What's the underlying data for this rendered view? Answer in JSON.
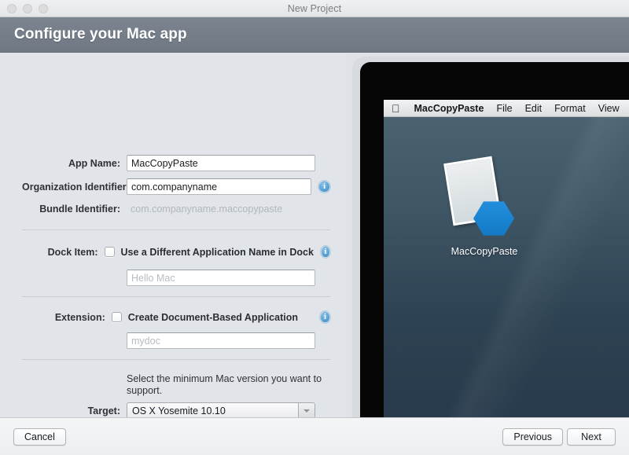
{
  "window": {
    "title": "New Project",
    "traffic_lights": [
      "close",
      "minimize",
      "zoom"
    ]
  },
  "header": {
    "title": "Configure your Mac app"
  },
  "form": {
    "app_name": {
      "label": "App Name:",
      "value": "MacCopyPaste"
    },
    "organization_identifier": {
      "label": "Organization Identifier:",
      "value": "com.companyname",
      "info": "i"
    },
    "bundle_identifier": {
      "label": "Bundle Identifier:",
      "value": "com.companyname.maccopypaste"
    },
    "dock_item": {
      "label": "Dock Item:",
      "checkbox_label": "Use a Different Application Name in Dock",
      "checked": false,
      "info": "i",
      "input_placeholder": "Hello Mac",
      "input_value": ""
    },
    "extension": {
      "label": "Extension:",
      "checkbox_label": "Create Document-Based Application",
      "checked": false,
      "info": "i",
      "input_placeholder": "mydoc",
      "input_value": ""
    },
    "target": {
      "help_text": "Select the minimum Mac version you want to support.",
      "label": "Target:",
      "value": "OS X Yosemite 10.10",
      "options": [
        "OS X Yosemite 10.10"
      ]
    }
  },
  "preview": {
    "menubar": {
      "apple_logo": "",
      "items": [
        "MacCopyPaste",
        "File",
        "Edit",
        "Format",
        "View"
      ]
    },
    "desktop_icon_label": "MacCopyPaste"
  },
  "footer": {
    "cancel": "Cancel",
    "previous": "Previous",
    "next": "Next"
  },
  "colors": {
    "header_band": "#6f7883",
    "accent_blue": "#1278c4",
    "info_blue": "#5ba2d6",
    "desktop_top": "#4a6270",
    "desktop_bottom": "#26384a"
  }
}
